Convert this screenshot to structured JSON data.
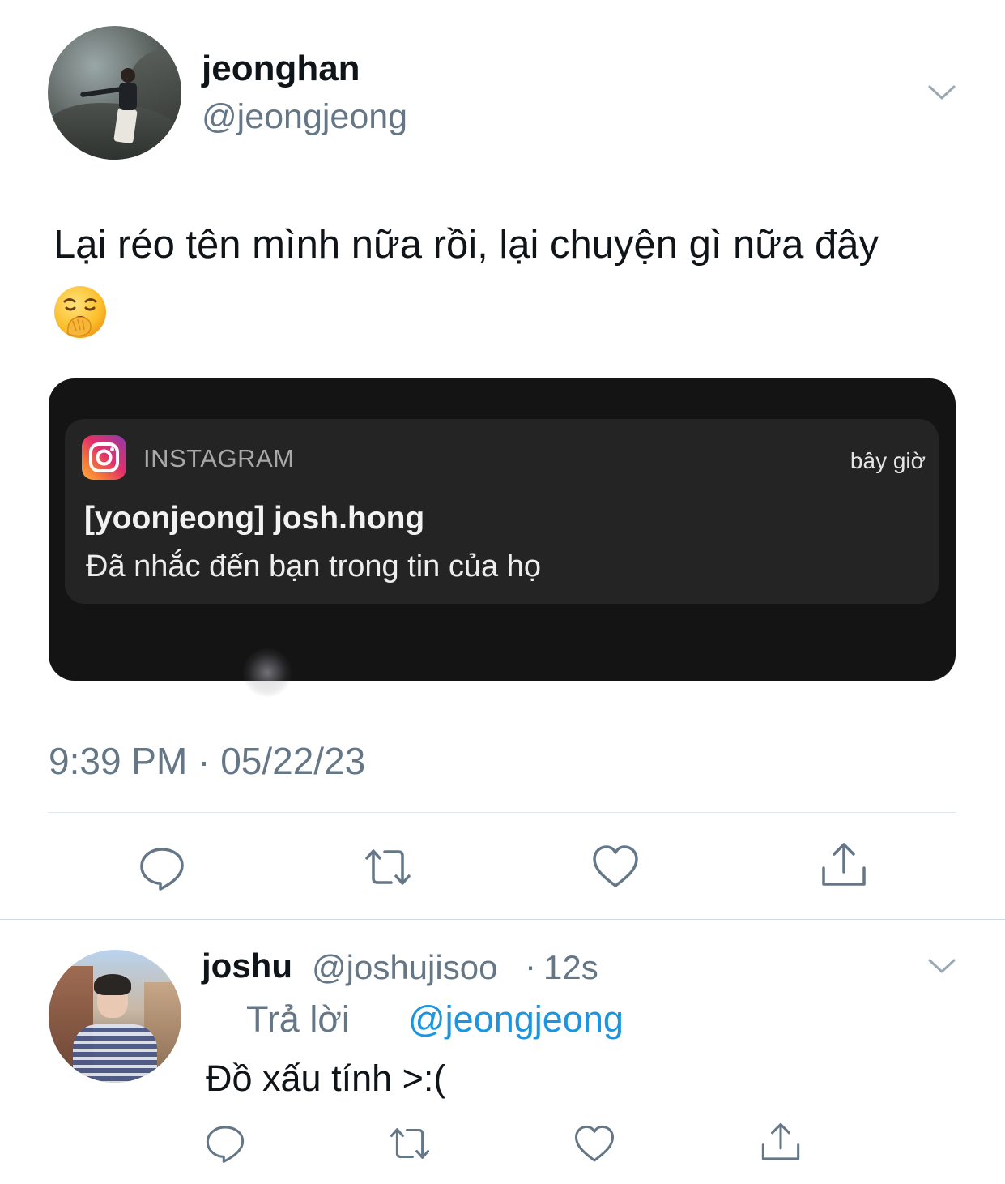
{
  "main_tweet": {
    "author_name": "jeonghan",
    "author_handle": "@jeongjeong",
    "text": "Lại réo tên mình nữa rồi, lại chuyện gì nữa đây",
    "emoji": "yawning-face",
    "timestamp": "9:39 PM · 05/22/23",
    "embedded_notification": {
      "app": "INSTAGRAM",
      "time": "bây giờ",
      "title": "[yoonjeong] josh.hong",
      "body": "Đã nhắc đến bạn trong tin của họ"
    },
    "actions": [
      "reply-icon",
      "retweet-icon",
      "like-icon",
      "share-icon"
    ]
  },
  "reply_tweet": {
    "author_name": "joshu",
    "author_handle": "@joshujisoo",
    "separator": "·",
    "time": "12s",
    "reply_to_label": "Trả lời",
    "reply_to_handle": "@jeongjeong",
    "text": "Đồ xấu tính >:(",
    "actions": [
      "reply-icon",
      "retweet-icon",
      "like-icon",
      "share-icon"
    ]
  },
  "colors": {
    "primary_text": "#0f1419",
    "secondary_text": "#657786",
    "link": "#1b95e0",
    "divider": "#e1e8ed",
    "notification_bg": "#242424"
  }
}
